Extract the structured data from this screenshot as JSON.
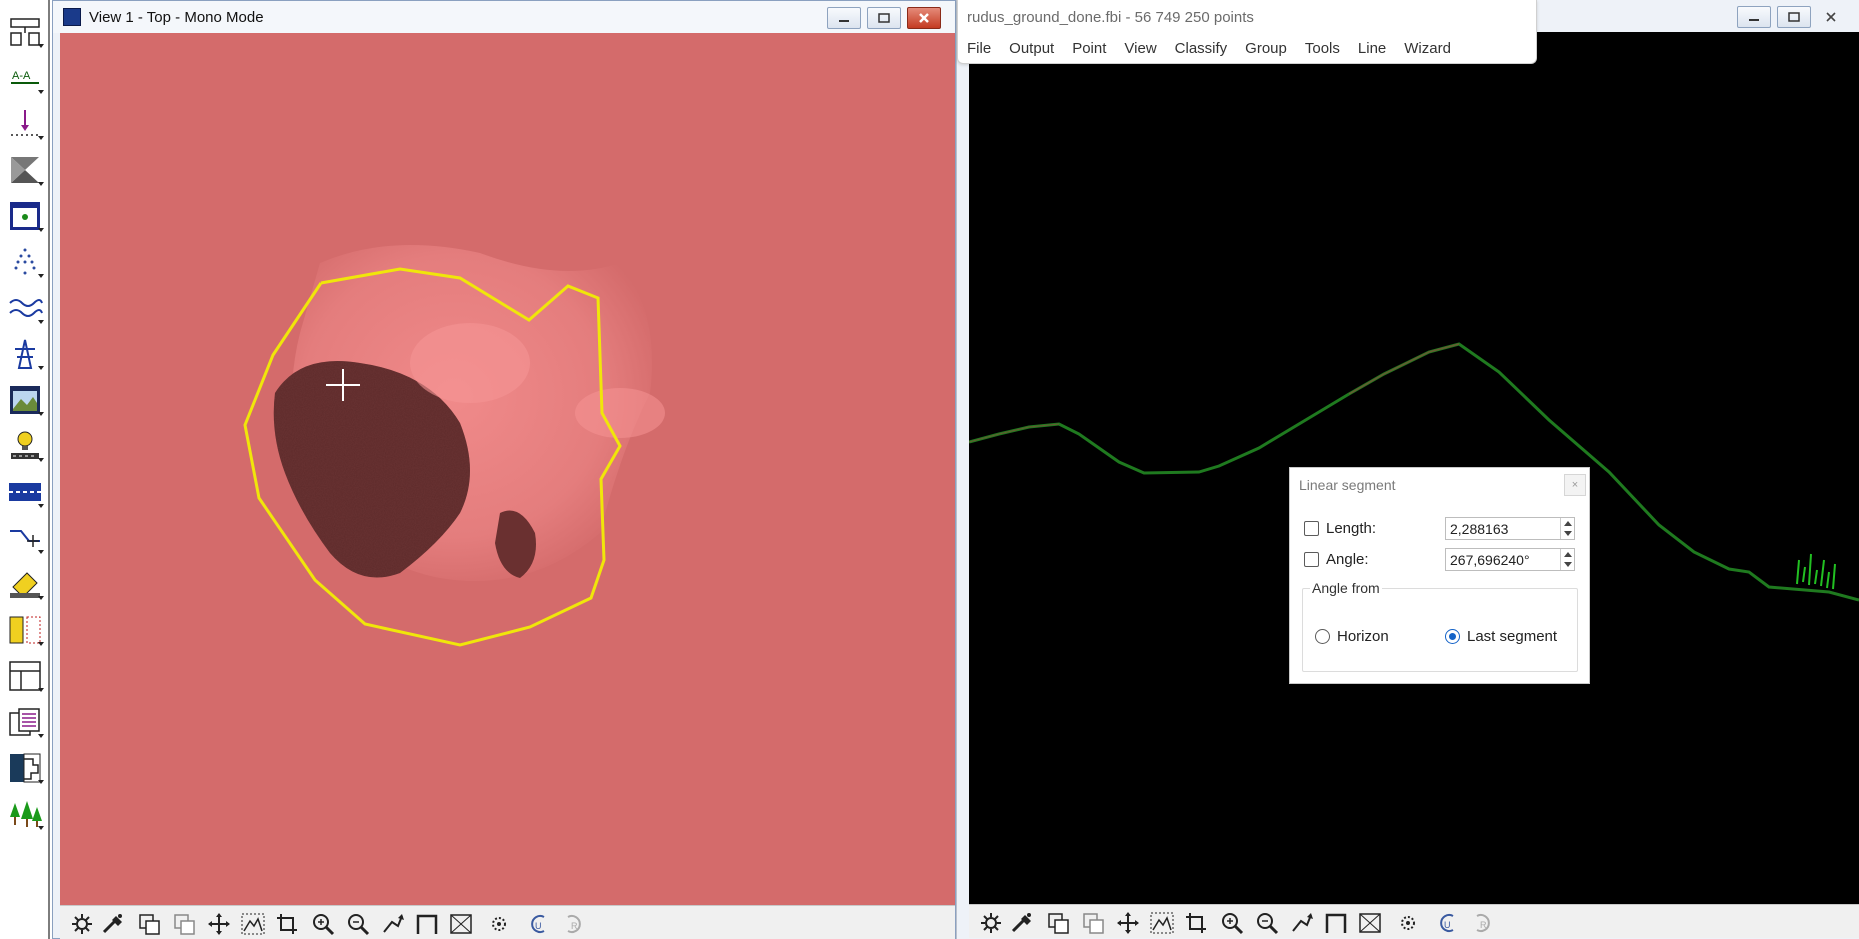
{
  "view1": {
    "title": "View 1 - Top - Mono Mode"
  },
  "app": {
    "title": "rudus_ground_done.fbi - 56 749 250 points",
    "menu": [
      "File",
      "Output",
      "Point",
      "View",
      "Classify",
      "Group",
      "Tools",
      "Line",
      "Wizard"
    ]
  },
  "dialog": {
    "title": "Linear segment",
    "close_label": "×",
    "length_label": "Length:",
    "length_value": "2,288163",
    "angle_label": "Angle:",
    "angle_value": "267,696240°",
    "angle_from_label": "Angle from",
    "option_horizon": "Horizon",
    "option_last_segment": "Last segment",
    "selected_option": "Last segment"
  },
  "left_toolbar_icons": [
    "network-icon",
    "section-icon",
    "drop-line-icon",
    "fill-icon",
    "view-window-icon",
    "tree-icon",
    "wave-icon",
    "tower-icon",
    "image-icon",
    "light-icon",
    "road-icon",
    "vector-icon",
    "eraser-icon",
    "split-view-icon",
    "layout-icon",
    "report-icon",
    "histogram-icon",
    "forest-icon"
  ],
  "bottom_toolbar_icons": [
    "settings-icon",
    "brush-icon",
    "copy-icon",
    "copy2-icon",
    "pan-icon",
    "mountain-icon",
    "crop-icon",
    "zoom-in-icon",
    "zoom-out-icon",
    "fit-icon",
    "frame-icon",
    "box-icon",
    "select-icon",
    "undo-icon",
    "redo-icon"
  ],
  "colors": {
    "terrain": "#d46b6b",
    "polygon": "#f0e60a",
    "profile_line": "#1f7a1f",
    "accent": "#1463c8"
  }
}
